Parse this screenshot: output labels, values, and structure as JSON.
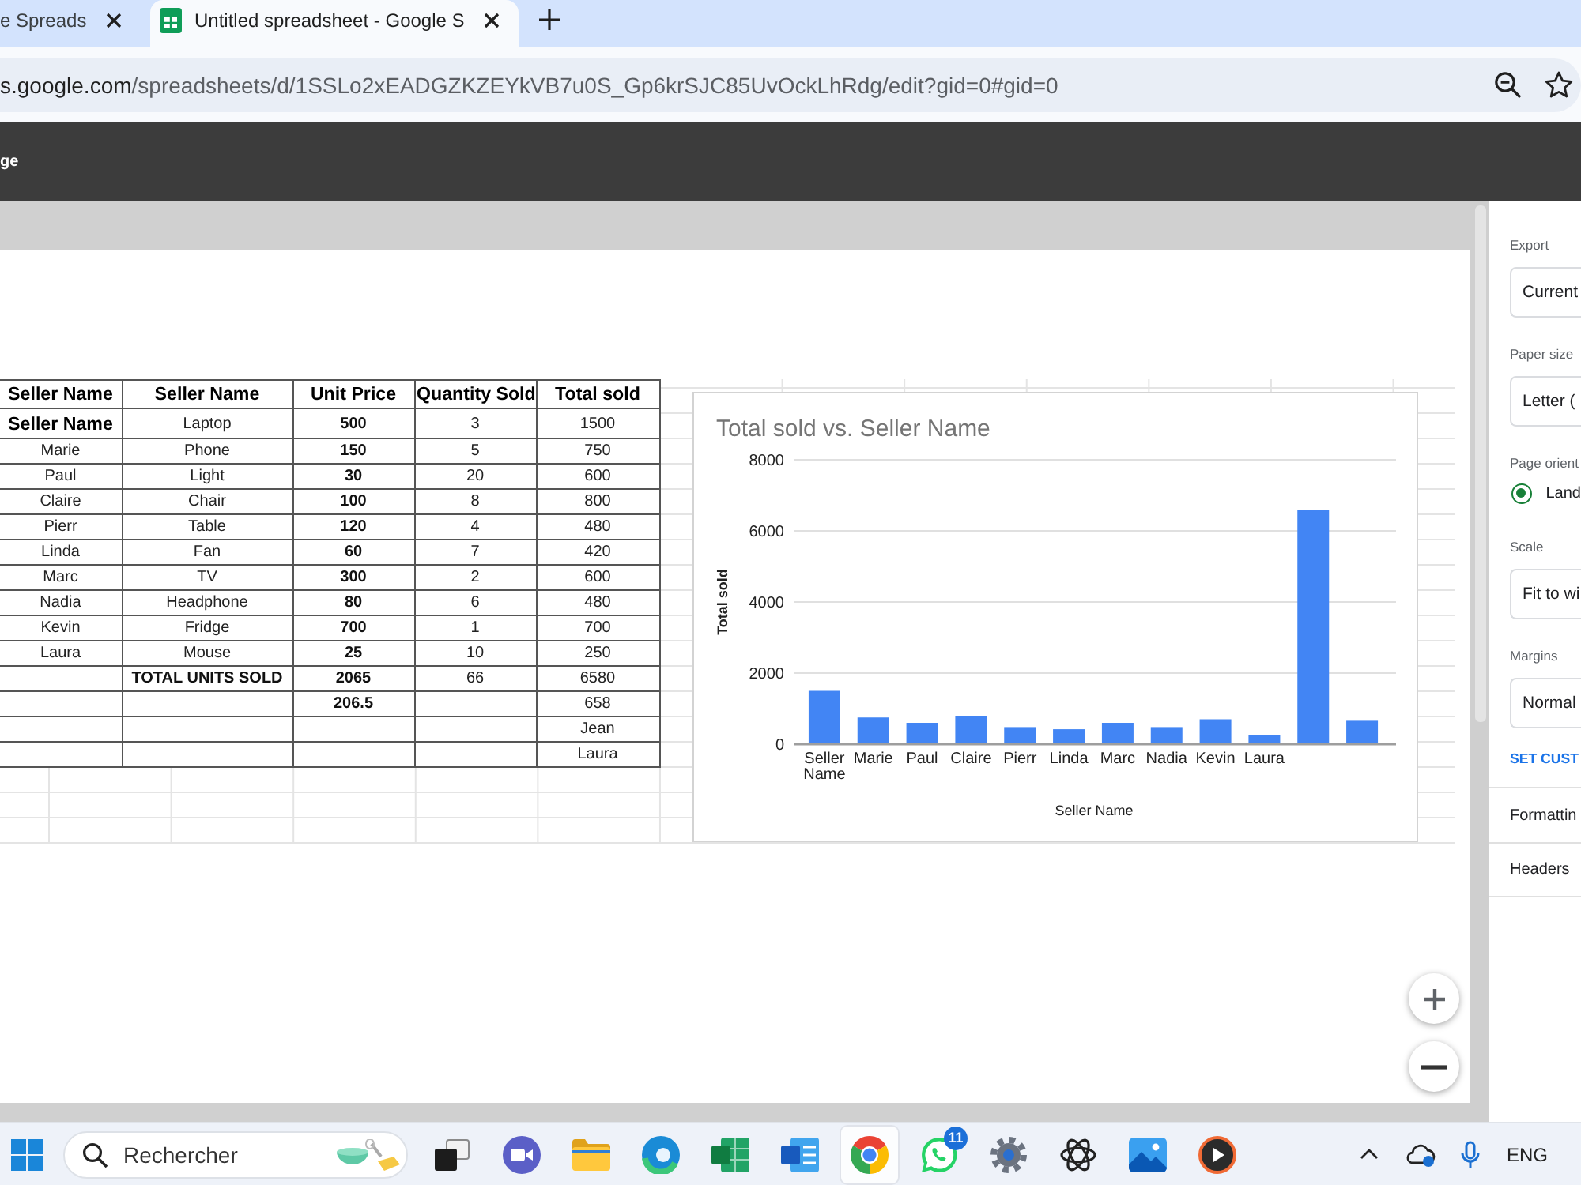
{
  "browser": {
    "tabs": [
      {
        "title": "e Spreads",
        "selected": false,
        "favicon": false
      },
      {
        "title": "Untitled spreadsheet - Google S",
        "selected": true,
        "favicon": true
      }
    ],
    "address": {
      "host": "s.google.com",
      "path": "/spreadsheets/d/1SSLo2xEADGZKZEYkVB7u0S_Gp6krSJC85UvOckLhRdg/edit?gid=0#gid=0"
    }
  },
  "header": {
    "title": "ge"
  },
  "sheet": {
    "columns": [
      "Seller Name",
      "Seller Name",
      "Unit Price",
      "Quantity Sold",
      "Total sold"
    ],
    "rows": [
      [
        {
          "text": "Seller Name",
          "kind": "header"
        },
        {
          "text": "Laptop",
          "kind": "value"
        },
        {
          "text": "500",
          "kind": "price"
        },
        {
          "text": "3",
          "kind": "value"
        },
        {
          "text": "1500",
          "kind": "value"
        }
      ],
      [
        {
          "text": "Marie",
          "kind": "value"
        },
        {
          "text": "Phone",
          "kind": "value"
        },
        {
          "text": "150",
          "kind": "price"
        },
        {
          "text": "5",
          "kind": "value"
        },
        {
          "text": "750",
          "kind": "value"
        }
      ],
      [
        {
          "text": "Paul",
          "kind": "value"
        },
        {
          "text": "Light",
          "kind": "value"
        },
        {
          "text": "30",
          "kind": "price"
        },
        {
          "text": "20",
          "kind": "value"
        },
        {
          "text": "600",
          "kind": "value"
        }
      ],
      [
        {
          "text": "Claire",
          "kind": "value"
        },
        {
          "text": "Chair",
          "kind": "value"
        },
        {
          "text": "100",
          "kind": "price"
        },
        {
          "text": "8",
          "kind": "value"
        },
        {
          "text": "800",
          "kind": "value"
        }
      ],
      [
        {
          "text": "Pierr",
          "kind": "value"
        },
        {
          "text": "Table",
          "kind": "value"
        },
        {
          "text": "120",
          "kind": "price"
        },
        {
          "text": "4",
          "kind": "value"
        },
        {
          "text": "480",
          "kind": "value"
        }
      ],
      [
        {
          "text": "Linda",
          "kind": "value"
        },
        {
          "text": "Fan",
          "kind": "value"
        },
        {
          "text": "60",
          "kind": "price"
        },
        {
          "text": "7",
          "kind": "value"
        },
        {
          "text": "420",
          "kind": "value"
        }
      ],
      [
        {
          "text": "Marc",
          "kind": "value"
        },
        {
          "text": "TV",
          "kind": "value"
        },
        {
          "text": "300",
          "kind": "price"
        },
        {
          "text": "2",
          "kind": "value"
        },
        {
          "text": "600",
          "kind": "value"
        }
      ],
      [
        {
          "text": "Nadia",
          "kind": "value"
        },
        {
          "text": "Headphone",
          "kind": "value"
        },
        {
          "text": "80",
          "kind": "price"
        },
        {
          "text": "6",
          "kind": "value"
        },
        {
          "text": "480",
          "kind": "value"
        }
      ],
      [
        {
          "text": "Kevin",
          "kind": "value"
        },
        {
          "text": "Fridge",
          "kind": "value"
        },
        {
          "text": "700",
          "kind": "price"
        },
        {
          "text": "1",
          "kind": "value"
        },
        {
          "text": "700",
          "kind": "value"
        }
      ],
      [
        {
          "text": "Laura",
          "kind": "value"
        },
        {
          "text": "Mouse",
          "kind": "value"
        },
        {
          "text": "25",
          "kind": "price"
        },
        {
          "text": "10",
          "kind": "value"
        },
        {
          "text": "250",
          "kind": "value"
        }
      ],
      [
        null,
        {
          "text": "TOTAL UNITS SOLD",
          "kind": "label"
        },
        {
          "text": "2065",
          "kind": "price"
        },
        {
          "text": "66",
          "kind": "value"
        },
        {
          "text": "6580",
          "kind": "value"
        }
      ],
      [
        null,
        null,
        {
          "text": "206.5",
          "kind": "price"
        },
        null,
        {
          "text": "658",
          "kind": "value"
        }
      ],
      [
        null,
        null,
        null,
        null,
        {
          "text": "Jean",
          "kind": "value"
        }
      ],
      [
        null,
        null,
        null,
        null,
        {
          "text": "Laura",
          "kind": "value"
        }
      ]
    ]
  },
  "chart": {
    "chart_data": {
      "type": "bar",
      "title": "Total sold vs. Seller Name",
      "xlabel": "Seller Name",
      "ylabel": "Total sold",
      "categories": [
        "Seller Name",
        "Marie",
        "Paul",
        "Claire",
        "Pierr",
        "Linda",
        "Marc",
        "Nadia",
        "Kevin",
        "Laura",
        null,
        null
      ],
      "series": [
        {
          "color": "#4285f4",
          "values": [
            1500,
            750,
            600,
            800,
            480,
            420,
            600,
            480,
            700,
            250,
            6580,
            658
          ]
        }
      ],
      "ylim": [
        0,
        8000
      ],
      "yticks": [
        0,
        2000,
        4000,
        6000,
        8000
      ],
      "grid": true
    }
  },
  "print_panel": {
    "sections": [
      {
        "kind": "select",
        "label": "Export",
        "value": "Current"
      },
      {
        "kind": "select",
        "label": "Paper size",
        "value": "Letter ("
      },
      {
        "kind": "radio",
        "label": "Page orient",
        "options": [
          {
            "label": "Land",
            "selected": true
          }
        ]
      },
      {
        "kind": "select",
        "label": "Scale",
        "value": "Fit to wi"
      },
      {
        "kind": "select",
        "label": "Margins",
        "value": "Normal"
      },
      {
        "kind": "link",
        "text": "SET CUST"
      }
    ],
    "rows": [
      "Formattin",
      "Headers"
    ]
  },
  "taskbar": {
    "search": {
      "placeholder": "Rechercher"
    },
    "apps": [
      {
        "kind": "taskview",
        "selected": false
      },
      {
        "kind": "camera",
        "selected": false
      },
      {
        "kind": "folder",
        "selected": false
      },
      {
        "kind": "swirl",
        "selected": false
      },
      {
        "kind": "grid",
        "selected": false
      },
      {
        "kind": "lines",
        "selected": false
      },
      {
        "kind": "wheel",
        "selected": true
      },
      {
        "kind": "chat",
        "selected": false,
        "badge": "11"
      },
      {
        "kind": "gear",
        "selected": false
      },
      {
        "kind": "knot",
        "selected": false
      },
      {
        "kind": "photo",
        "selected": false
      },
      {
        "kind": "player",
        "selected": false
      }
    ],
    "language": "ENG"
  }
}
